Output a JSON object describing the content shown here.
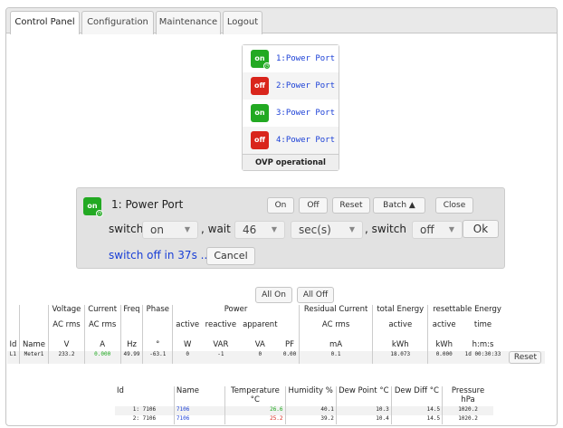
{
  "tabs": [
    "Control Panel",
    "Configuration",
    "Maintenance",
    "Logout"
  ],
  "ports": [
    {
      "state": "on",
      "label": "1:Power Port",
      "color": "#22a922",
      "timer": true
    },
    {
      "state": "off",
      "label": "2:Power Port",
      "color": "#d9251c",
      "timer": false
    },
    {
      "state": "on",
      "label": "3:Power Port",
      "color": "#22a922",
      "timer": false
    },
    {
      "state": "off",
      "label": "4:Power Port",
      "color": "#d9251c",
      "timer": false
    }
  ],
  "ovp_status": "OVP operational",
  "panel": {
    "state": "on",
    "title": "1: Power Port",
    "buttons": {
      "on": "On",
      "off": "Off",
      "reset": "Reset",
      "batch": "Batch ▲",
      "close": "Close"
    },
    "switch_label": "switch",
    "switch_value": "on",
    "wait_label": ", wait",
    "wait_value": "46",
    "unit_value": "sec(s)",
    "switch2_label": ", switch",
    "switch2_value": "off",
    "ok": "Ok",
    "countdown": "switch off in 37s ...",
    "cancel": "Cancel"
  },
  "all_on": "All On",
  "all_off": "All Off",
  "meter": {
    "groups": [
      "Voltage",
      "Current",
      "Freq",
      "Phase",
      "Power",
      "Residual Current",
      "total Energy",
      "resettable Energy"
    ],
    "sub1": [
      "AC rms",
      "AC rms",
      "active",
      "reactive",
      "apparent",
      "AC rms",
      "active",
      "active",
      "time"
    ],
    "headers": [
      "Id",
      "Name",
      "V",
      "A",
      "Hz",
      "°",
      "W",
      "VAR",
      "VA",
      "PF",
      "mA",
      "kWh",
      "kWh",
      "h:m:s"
    ],
    "row": [
      "L1",
      "Meter1",
      "233.2",
      "0.000",
      "49.99",
      "-63.1",
      "0",
      "-1",
      "0",
      "0.00",
      "0.1",
      "18.073",
      "0.000",
      "1d 00:30:33"
    ],
    "reset": "Reset"
  },
  "env": {
    "headers": [
      "Id",
      "Name",
      "Temperature °C",
      "Humidity %",
      "Dew Point °C",
      "Dew Diff °C",
      "Pressure hPa"
    ],
    "rows": [
      [
        "1: 7106",
        "7106",
        "26.6",
        "40.1",
        "10.3",
        "14.5",
        "1020.2"
      ],
      [
        "2: 7106",
        "7106",
        "25.2",
        "39.2",
        "10.4",
        "14.5",
        "1020.2"
      ]
    ]
  }
}
